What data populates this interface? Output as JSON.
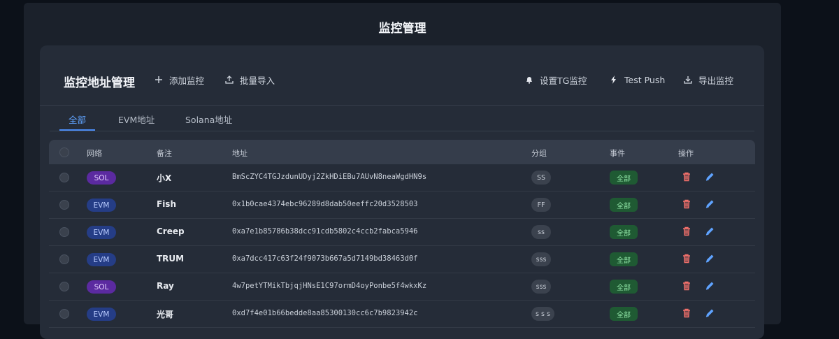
{
  "page": {
    "title": "监控管理"
  },
  "card": {
    "title": "监控地址管理",
    "buttons": {
      "add": "添加监控",
      "import": "批量导入",
      "tg": "设置TG监控",
      "test_push": "Test Push",
      "export": "导出监控"
    }
  },
  "tabs": [
    {
      "label": "全部",
      "active": true
    },
    {
      "label": "EVM地址",
      "active": false
    },
    {
      "label": "Solana地址",
      "active": false
    }
  ],
  "table": {
    "headers": {
      "network": "网络",
      "note": "备注",
      "address": "地址",
      "group": "分组",
      "event": "事件",
      "action": "操作"
    },
    "rows": [
      {
        "network": "SOL",
        "note": "小X",
        "address": "BmScZYC4TGJzdunUDyj2ZkHDiEBu7AUvN8neaWgdHN9s",
        "group": "SS",
        "event": "全部"
      },
      {
        "network": "EVM",
        "note": "Fish",
        "address": "0x1b0cae4374ebc96289d8dab50eeffc20d3528503",
        "group": "FF",
        "event": "全部"
      },
      {
        "network": "EVM",
        "note": "Creep",
        "address": "0xa7e1b85786b38dcc91cdb5802c4ccb2fabca5946",
        "group": "ss",
        "event": "全部"
      },
      {
        "network": "EVM",
        "note": "TRUM",
        "address": "0xa7dcc417c63f24f9073b667a5d7149bd38463d0f",
        "group": "sss",
        "event": "全部"
      },
      {
        "network": "SOL",
        "note": "Ray",
        "address": "4w7petYTMikTbjqjHNsE1C97ormD4oyPonbe5f4wkxKz",
        "group": "sss",
        "event": "全部"
      },
      {
        "network": "EVM",
        "note": "光哥",
        "address": "0xd7f4e01b66bedde8aa85300130cc6c7b9823942c",
        "group": "s s s",
        "event": "全部"
      }
    ]
  },
  "colors": {
    "accent": "#4c8df6",
    "delete": "#f2706b",
    "edit": "#5fa3ff",
    "event_bg": "#1f5a33",
    "sol_badge": "#5b2aa0",
    "evm_badge": "#253d86"
  },
  "icons": {
    "add": "plus-icon",
    "import": "upload-icon",
    "tg": "bell-icon",
    "test_push": "lightning-icon",
    "export": "download-icon",
    "delete": "trash-icon",
    "edit": "pencil-icon"
  }
}
